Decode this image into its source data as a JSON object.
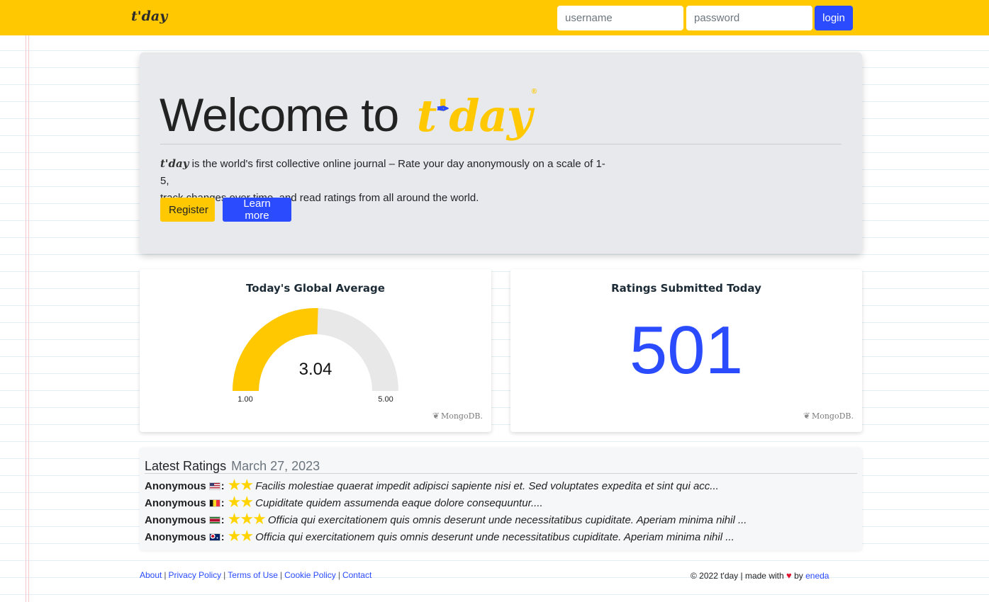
{
  "navbar": {
    "brand": "t'day",
    "username_placeholder": "username",
    "password_placeholder": "password",
    "login_label": "login",
    "background_color": "#ffc800"
  },
  "jumbotron": {
    "welcome_prefix": "Welcome to",
    "logo_text": "t'day",
    "lead_logo": "t'day",
    "lead_text_1": " is the world's first collective online journal – Rate your day anonymously on a scale of 1-5,",
    "lead_text_2": "track changes over time, and read ratings from all around the world.",
    "register_label": "Register",
    "learn_more_label": "Learn more"
  },
  "average_card": {
    "title": "Today's Global Average",
    "min_label": "1.00",
    "max_label": "5.00",
    "value_label": "3.04",
    "attribution": "MongoDB."
  },
  "count_card": {
    "title": "Ratings Submitted Today",
    "value": "501",
    "attribution": "MongoDB."
  },
  "chart_data": {
    "type": "gauge",
    "title": "Today's Global Average",
    "value": 3.04,
    "min": 1,
    "max": 5,
    "colors": {
      "fill": "#ffc800",
      "track": "#e8e8e8"
    }
  },
  "latest": {
    "heading": "Latest Ratings",
    "date": "March 27, 2023",
    "ratings": [
      {
        "user": "Anonymous",
        "flag": "us-flag-icon",
        "stars": 2,
        "text": "Facilis molestiae quaerat impedit adipisci sapiente nisi et. Sed voluptates expedita et sint qui acc..."
      },
      {
        "user": "Anonymous",
        "flag": "be-flag-icon",
        "stars": 2,
        "text": "Cupiditate quidem assumenda eaque dolore consequuntur...."
      },
      {
        "user": "Anonymous",
        "flag": "sr-flag-icon",
        "stars": 3,
        "text": "Officia qui exercitationem quis omnis deserunt unde necessitatibus cupiditate. Aperiam minima nihil ..."
      },
      {
        "user": "Anonymous",
        "flag": "au-flag-icon",
        "stars": 2,
        "text": "Officia qui exercitationem quis omnis deserunt unde necessitatibus cupiditate. Aperiam minima nihil ..."
      }
    ]
  },
  "footer": {
    "links": [
      "About",
      "Privacy Policy",
      "Terms of Use",
      "Cookie Policy",
      "Contact"
    ],
    "copyright_prefix": "© 2022 t'day | made with",
    "by": "by",
    "author": "eneda"
  },
  "colors": {
    "accent_yellow": "#ffc800",
    "accent_blue": "#2b4bff"
  }
}
